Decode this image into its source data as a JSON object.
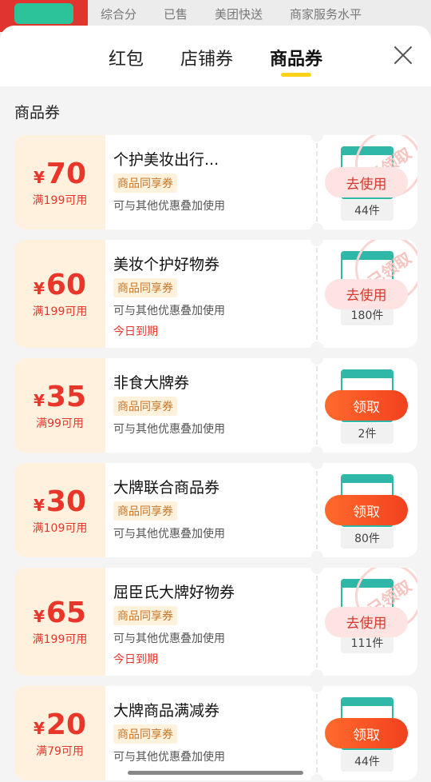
{
  "background": {
    "tabs": [
      "综合分",
      "已售",
      "美团快送",
      "商家服务水平"
    ]
  },
  "sheet": {
    "tabs": [
      {
        "label": "红包"
      },
      {
        "label": "店铺券"
      },
      {
        "label": "商品券"
      }
    ],
    "section_title": "商品券"
  },
  "coupons": [
    {
      "yen": "¥",
      "amount": "70",
      "condition": "满199可用",
      "name": "个护美妆出行...",
      "tag": "商品同享券",
      "desc": "可与其他优惠叠加使用",
      "expire": "",
      "count": "44件",
      "button": "去使用",
      "type": "use",
      "stamp": "已领取",
      "height": 118
    },
    {
      "yen": "¥",
      "amount": "60",
      "condition": "满199可用",
      "name": "美妆个护好物券",
      "tag": "商品同享券",
      "desc": "可与其他优惠叠加使用",
      "expire": "今日到期",
      "count": "180件",
      "button": "去使用",
      "type": "use",
      "stamp": "已领取",
      "height": 135
    },
    {
      "yen": "¥",
      "amount": "35",
      "condition": "满99可用",
      "name": "非食大牌券",
      "tag": "商品同享券",
      "desc": "可与其他优惠叠加使用",
      "expire": "",
      "count": "2件",
      "button": "领取",
      "type": "get",
      "stamp": "",
      "height": 118
    },
    {
      "yen": "¥",
      "amount": "30",
      "condition": "满109可用",
      "name": "大牌联合商品券",
      "tag": "商品同享券",
      "desc": "可与其他优惠叠加使用",
      "expire": "",
      "count": "80件",
      "button": "领取",
      "type": "get",
      "stamp": "",
      "height": 118
    },
    {
      "yen": "¥",
      "amount": "65",
      "condition": "满199可用",
      "name": "屈臣氏大牌好物券",
      "tag": "商品同享券",
      "desc": "可与其他优惠叠加使用",
      "expire": "今日到期",
      "count": "111件",
      "button": "去使用",
      "type": "use",
      "stamp": "已领取",
      "height": 135
    },
    {
      "yen": "¥",
      "amount": "20",
      "condition": "满79可用",
      "name": "大牌商品满减券",
      "tag": "商品同享券",
      "desc": "可与其他优惠叠加使用",
      "expire": "",
      "count": "44件",
      "button": "领取",
      "type": "get",
      "stamp": "",
      "height": 118
    }
  ],
  "colors": {
    "accent": "#e8372a",
    "tab_underline": "#ffd21a",
    "coupon_left_bg": "#fff1dd",
    "thumb_border": "#2fb7a8"
  }
}
